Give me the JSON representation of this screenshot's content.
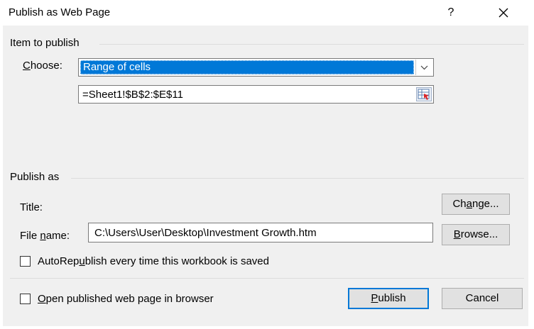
{
  "window": {
    "title": "Publish as Web Page",
    "help_glyph": "?",
    "close_glyph": "✕"
  },
  "item_group": {
    "label": "Item to publish",
    "choose_label_accel": "C",
    "choose_label_rest": "hoose:",
    "choose_value": "Range of cells",
    "range_value": "=Sheet1!$B$2:$E$11"
  },
  "publish_group": {
    "label": "Publish as",
    "title_label": "Title:",
    "change_button": {
      "before": "Ch",
      "accel": "a",
      "after": "nge..."
    },
    "file_label": {
      "before": "File ",
      "accel": "n",
      "after": "ame:"
    },
    "file_value": "C:\\Users\\User\\Desktop\\Investment Growth.htm",
    "browse_button": {
      "before": "",
      "accel": "B",
      "after": "rowse..."
    },
    "autorepublish": {
      "before": "AutoRep",
      "accel": "u",
      "after": "blish every time this workbook is saved",
      "checked": false
    }
  },
  "footer": {
    "open_browser": {
      "before": "",
      "accel": "O",
      "after": "pen published web page in browser",
      "checked": false
    },
    "publish_button": {
      "before": "",
      "accel": "P",
      "after": "ublish"
    },
    "cancel_button": "Cancel"
  },
  "colors": {
    "accent": "#0078d7",
    "client_bg": "#f0f0f0"
  }
}
